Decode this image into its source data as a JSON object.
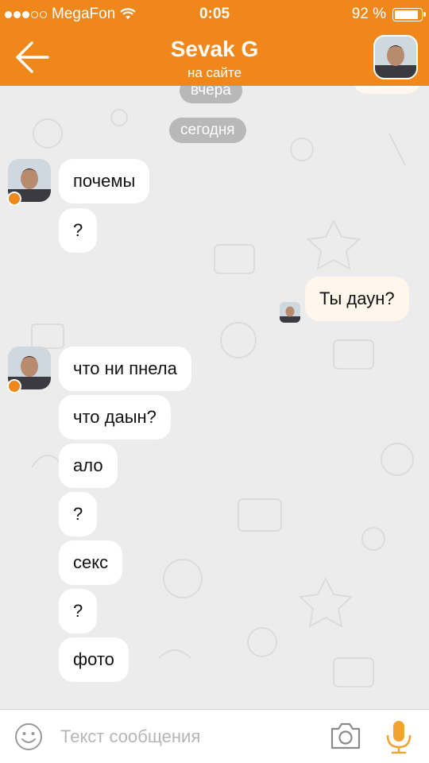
{
  "status_bar": {
    "carrier": "MegaFon",
    "time": "0:05",
    "battery_percent": "92 %",
    "battery_level": 0.92,
    "signal_bars_filled": 3,
    "signal_bars_total": 5
  },
  "header": {
    "contact_name": "Sevak G",
    "status": "на сайте"
  },
  "chat": {
    "date_pills": [
      "вчера",
      "сегодня"
    ],
    "messages": [
      {
        "direction": "in",
        "text": "почемы"
      },
      {
        "direction": "in",
        "text": "?"
      },
      {
        "direction": "out",
        "text": "Ты даун?"
      },
      {
        "direction": "in",
        "text": "что ни пнела"
      },
      {
        "direction": "in",
        "text": "что даын?"
      },
      {
        "direction": "in",
        "text": "ало"
      },
      {
        "direction": "in",
        "text": "?"
      },
      {
        "direction": "in",
        "text": "секс"
      },
      {
        "direction": "in",
        "text": "?"
      },
      {
        "direction": "in",
        "text": "фото"
      }
    ]
  },
  "input": {
    "placeholder": "Текст сообщения",
    "value": ""
  },
  "colors": {
    "accent": "#f0871a",
    "background": "#ececec",
    "incoming_bubble": "#ffffff",
    "outgoing_bubble": "#fff6ec",
    "date_pill": "#b8b8b8"
  },
  "icons": [
    "back-arrow-icon",
    "wifi-icon",
    "battery-icon",
    "emoji-icon",
    "camera-icon",
    "microphone-icon"
  ]
}
